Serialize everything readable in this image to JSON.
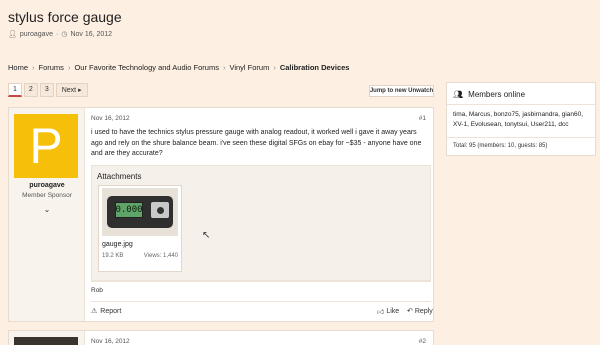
{
  "thread": {
    "title": "stylus force gauge",
    "author": "puroagave",
    "date": "Nov 16, 2012"
  },
  "breadcrumb": [
    "Home",
    "Forums",
    "Our Favorite Technology and Audio Forums",
    "Vinyl Forum",
    "Calibration Devices"
  ],
  "pager": {
    "pages": [
      "1",
      "2",
      "3"
    ],
    "current": "1",
    "next_label": "Next"
  },
  "jump_label": "Jump to new Unwatch",
  "posts": [
    {
      "username": "puroagave",
      "user_title": "Member Sponsor",
      "avatar_letter": "P",
      "date": "Nov 16, 2012",
      "number": "#1",
      "body": "i used to have the technics stylus pressure gauge with analog readout, it worked well i gave it away years ago and rely on the shure balance beam. i've seen these digital SFGs on ebay for ~$35 - anyone have one and are they accurate?",
      "attachments_title": "Attachments",
      "attachment": {
        "file_name": "gauge.jpg",
        "size": "19.2 KB",
        "views": "Views: 1,440",
        "screen_reading": "0.000"
      },
      "signature": "Rob",
      "actions": {
        "report": "Report",
        "like": "Like",
        "reply": "Reply"
      }
    },
    {
      "date": "Nov 16, 2012",
      "number": "#2"
    }
  ],
  "members_online": {
    "title": "Members online",
    "list": "tima, Marcus, bonzo75, jasbirnandra, gian60, XV-1, Evolusean, tonytsui, User211, dcc",
    "total": "Total: 95 (members: 10, guests: 85)"
  },
  "colors": {
    "background": "#fdefe2",
    "avatar": "#f5bf0a",
    "pager_active": "#c84545"
  }
}
